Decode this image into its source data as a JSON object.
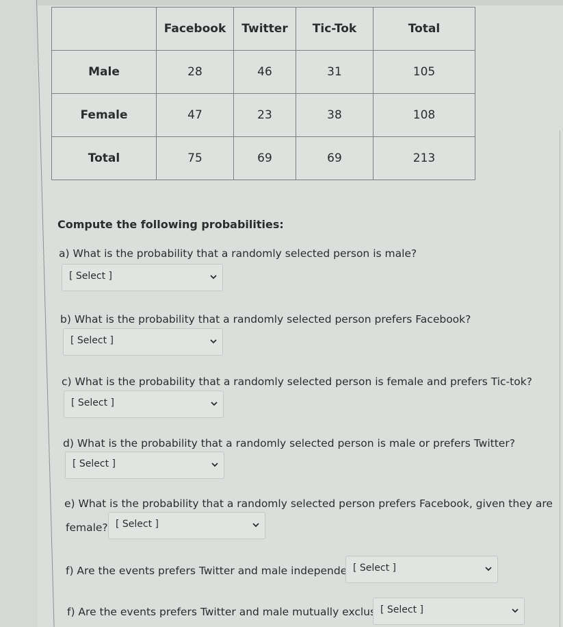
{
  "table": {
    "headers": [
      "",
      "Facebook",
      "Twitter",
      "Tic-Tok",
      "Total"
    ],
    "rows": [
      {
        "label": "Male",
        "values": [
          "28",
          "46",
          "31",
          "105"
        ]
      },
      {
        "label": "Female",
        "values": [
          "47",
          "23",
          "38",
          "108"
        ]
      },
      {
        "label": "Total",
        "values": [
          "75",
          "69",
          "69",
          "213"
        ]
      }
    ]
  },
  "intro": "Compute the following probabilities:",
  "questions": [
    {
      "id": "a",
      "text": "a)  What is the probability that a randomly selected person is male?",
      "select": "[ Select ]"
    },
    {
      "id": "b",
      "text": "b)  What is the probability that a randomly selected person prefers Facebook?",
      "select": "[ Select ]"
    },
    {
      "id": "c",
      "text": "c) What is the probability that a randomly selected person is female and prefers Tic-tok?",
      "select": "[ Select ]"
    },
    {
      "id": "d",
      "text": "d) What is the probability that a randomly selected person is male or prefers Twitter?",
      "select": "[ Select ]"
    },
    {
      "id": "e",
      "text": "e) What is the probability that a randomly selected person prefers Facebook, given they are",
      "text_continued": "female?",
      "select": "[ Select ]"
    },
    {
      "id": "f1",
      "text": "f) Are the events prefers Twitter and male independent?",
      "select": "[ Select ]"
    },
    {
      "id": "f2",
      "text": "f) Are the events prefers Twitter and male mutually exclusive?",
      "select": "[ Select ]"
    }
  ]
}
